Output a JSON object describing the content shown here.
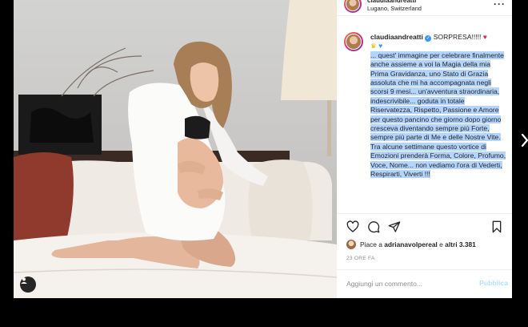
{
  "post": {
    "location": "Lugano, Switzerland",
    "caption_user": "claudiaandreatti",
    "caption_first": "SORPRESA!!!!!",
    "caption_text": "... quest' immagine per celebrare finalmente anche assieme a voi la Magia della mia Prima Gravidanza, uno Stato di Grazia assoluta che mi ha accompagnata negli scorsi 9 mesi... un'avventura straordinaria, indescrivibile... goduta in totale Riservatezza, Rispetto, Passione e Amore per questo pancino che giorno dopo giorno cresceva diventando sempre più Forte, sempre più parte di Me e delle Nostre Vite. Tra alcune settimane questo vortice di Emozioni prenderà Forma, Colore, Profumo, Voce, Nome... non vediamo l'ora di Vederti, Respirarti, Viverti !!!",
    "likes_prefix": "Piace a",
    "likes_user": "adrianavolpereal",
    "likes_mid": "e",
    "likes_rest": "altri 3.381",
    "time": "23 ORE FA"
  },
  "comment_box": {
    "placeholder": "Aggiungi un commento...",
    "publish": "Pubblica"
  },
  "icons": {
    "verified": "verified-badge",
    "heart_emoji": "red-heart",
    "blue_heart_emoji": "blue-heart",
    "crown_emoji": "crown",
    "like": "heart-outline",
    "comment": "speech-bubble",
    "share": "paper-plane",
    "save": "bookmark",
    "tag": "user-tag",
    "next": "chevron-right"
  },
  "colors": {
    "verified": "#3897f0",
    "selection": "#b3d4fc",
    "publish": "#b2dffc",
    "muted": "#8e8e8e"
  }
}
